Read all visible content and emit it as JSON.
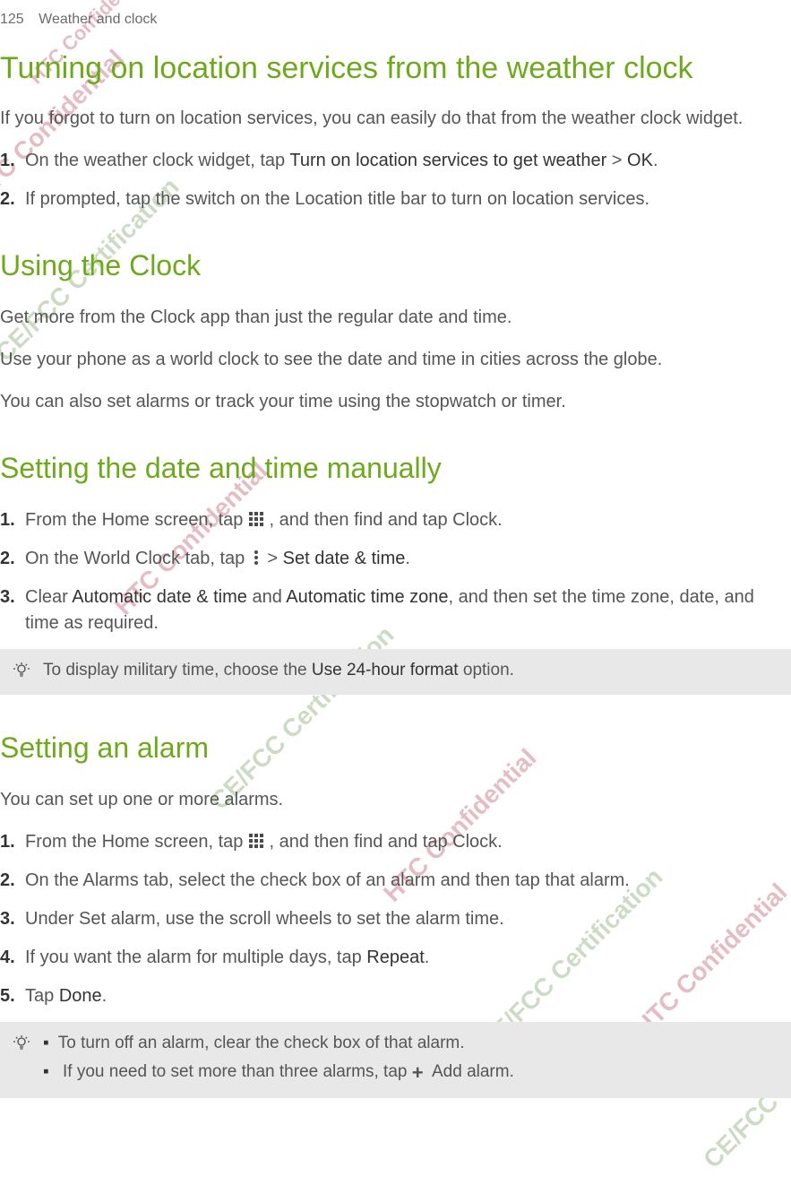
{
  "page": {
    "number": "125",
    "section": "Weather and clock"
  },
  "watermarks": {
    "htc_conf": "HTC Confidential",
    "cefcc": "CE/FCC Certification"
  },
  "section1": {
    "title": "Turning on location services from the weather clock",
    "intro": "If you forgot to turn on location services, you can easily do that from the weather clock widget.",
    "steps": {
      "s1a": "On the weather clock widget, tap ",
      "s1b_bold": "Turn on location services to get weather",
      "s1c": " > ",
      "s1d_bold": "OK",
      "s1e": ".",
      "s2": "If prompted, tap the switch on the Location title bar to turn on location services."
    }
  },
  "section2": {
    "title": "Using the Clock",
    "p1": "Get more from the Clock app than just the regular date and time.",
    "p2": "Use your phone as a world clock to see the date and time in cities across the globe.",
    "p3": "You can also set alarms or track your time using the stopwatch or timer."
  },
  "section3": {
    "title": "Setting the date and time manually",
    "steps": {
      "s1a": " From the Home screen, tap ",
      "s1b": ", and then find and tap Clock.",
      "s2a": "On the World Clock tab, tap  ",
      "s2b": " > ",
      "s2c_bold": "Set date & time",
      "s2d": ".",
      "s3a": "Clear ",
      "s3b_bold": "Automatic date & time",
      "s3c": " and ",
      "s3d_bold": "Automatic time zone",
      "s3e": ", and then set the time zone, date, and time as required."
    },
    "tip": {
      "a": "To display military time, choose the ",
      "b_bold": "Use 24-hour format",
      "c": " option."
    }
  },
  "section4": {
    "title": "Setting an alarm",
    "intro": "You can set up one or more alarms.",
    "steps": {
      "s1a": " From the Home screen, tap ",
      "s1b": ", and then find and tap Clock.",
      "s2": "On the Alarms tab, select the check box of an alarm and then tap that alarm.",
      "s3": "Under Set alarm, use the scroll wheels to set the alarm time.",
      "s4a": "If you want the alarm for multiple days, tap ",
      "s4b_bold": "Repeat",
      "s4c": ".",
      "s5a": "Tap ",
      "s5b_bold": "Done",
      "s5c": "."
    },
    "tip": {
      "li1": "To turn off an alarm, clear the check box of that alarm.",
      "li2a": "If you need to set more than three alarms, tap ",
      "li2b": "Add alarm."
    }
  },
  "nums": {
    "n1": "1.",
    "n2": "2.",
    "n3": "3.",
    "n4": "4.",
    "n5": "5."
  }
}
